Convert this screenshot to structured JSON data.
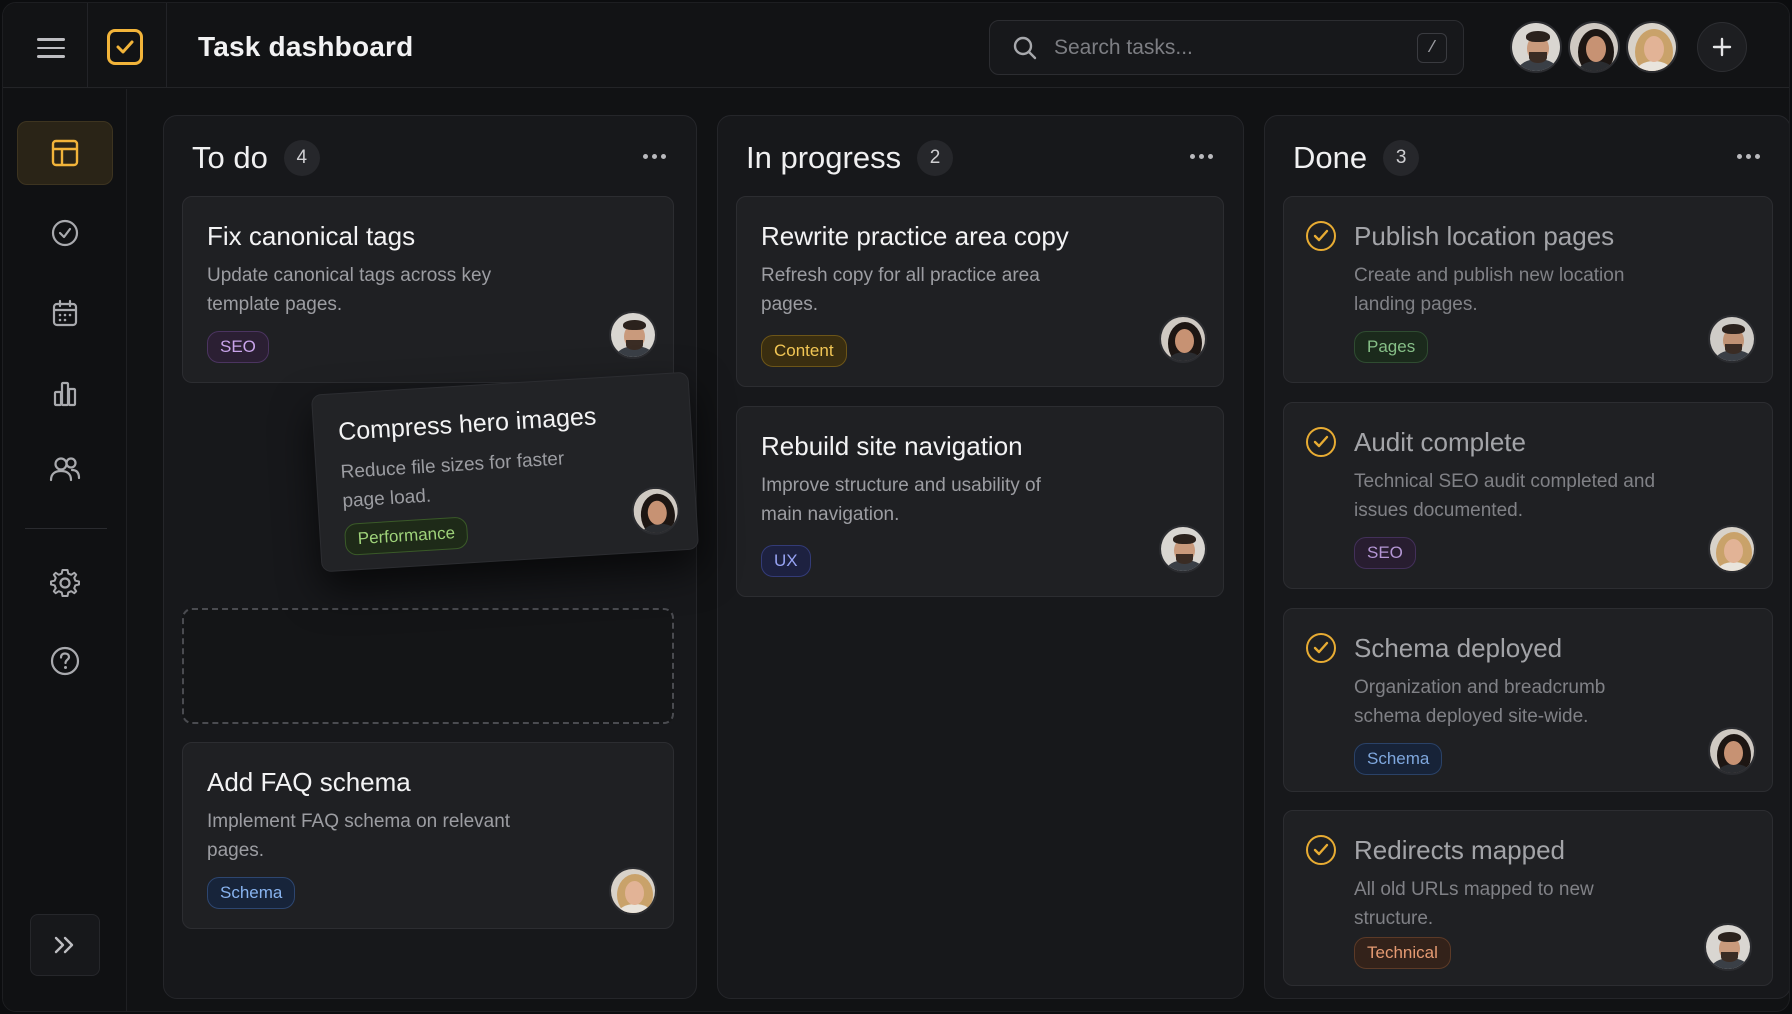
{
  "app": {
    "title": "Task dashboard"
  },
  "search": {
    "placeholder": "Search tasks...",
    "shortcut": "/"
  },
  "header": {
    "team_avatars": [
      "man-avatar",
      "woman-dark-hair-avatar",
      "woman-blonde-avatar"
    ],
    "add_button_icon": "plus-icon"
  },
  "sidebar": {
    "items": [
      {
        "icon": "board-icon",
        "active": true
      },
      {
        "icon": "check-circle-icon",
        "active": false
      },
      {
        "icon": "calendar-icon",
        "active": false
      },
      {
        "icon": "bar-chart-icon",
        "active": false
      },
      {
        "icon": "users-icon",
        "active": false
      },
      {
        "icon": "gear-icon",
        "active": false
      },
      {
        "icon": "help-icon",
        "active": false
      }
    ],
    "collapse_icon": "double-chevron-right-icon"
  },
  "colors": {
    "accent": "#f2b43a",
    "background": "#111214",
    "card": "#1f2023"
  },
  "columns": [
    {
      "title": "To do",
      "count": "4",
      "cards": [
        {
          "title": "Fix canonical tags",
          "description": "Update canonical tags across key template pages.",
          "tag": "SEO",
          "assignee": "man"
        },
        {
          "title": "Compress hero images",
          "description": "Reduce file sizes for faster page load.",
          "tag": "Performance",
          "assignee": "woman-dark",
          "state": "dragging"
        },
        {
          "title": "Add FAQ schema",
          "description": "Implement FAQ schema on relevant pages.",
          "tag": "Schema",
          "assignee": "woman-blonde"
        }
      ]
    },
    {
      "title": "In progress",
      "count": "2",
      "cards": [
        {
          "title": "Rewrite practice area copy",
          "description": "Refresh copy for all practice area pages.",
          "tag": "Content",
          "assignee": "woman-dark"
        },
        {
          "title": "Rebuild site navigation",
          "description": "Improve structure and usability of main navigation.",
          "tag": "UX",
          "assignee": "man"
        }
      ]
    },
    {
      "title": "Done",
      "count": "3",
      "cards": [
        {
          "title": "Publish location pages",
          "description": "Create and publish new location landing pages.",
          "tag": "Pages",
          "assignee": "man"
        },
        {
          "title": "Audit complete",
          "description": "Technical SEO audit completed and issues documented.",
          "tag": "SEO",
          "assignee": "woman-blonde"
        },
        {
          "title": "Schema deployed",
          "description": "Organization and breadcrumb schema deployed site-wide.",
          "tag": "Schema",
          "assignee": "woman-dark"
        },
        {
          "title": "Redirects mapped",
          "description": "All old URLs mapped to new structure.",
          "tag": "Technical",
          "assignee": "man"
        }
      ]
    }
  ]
}
